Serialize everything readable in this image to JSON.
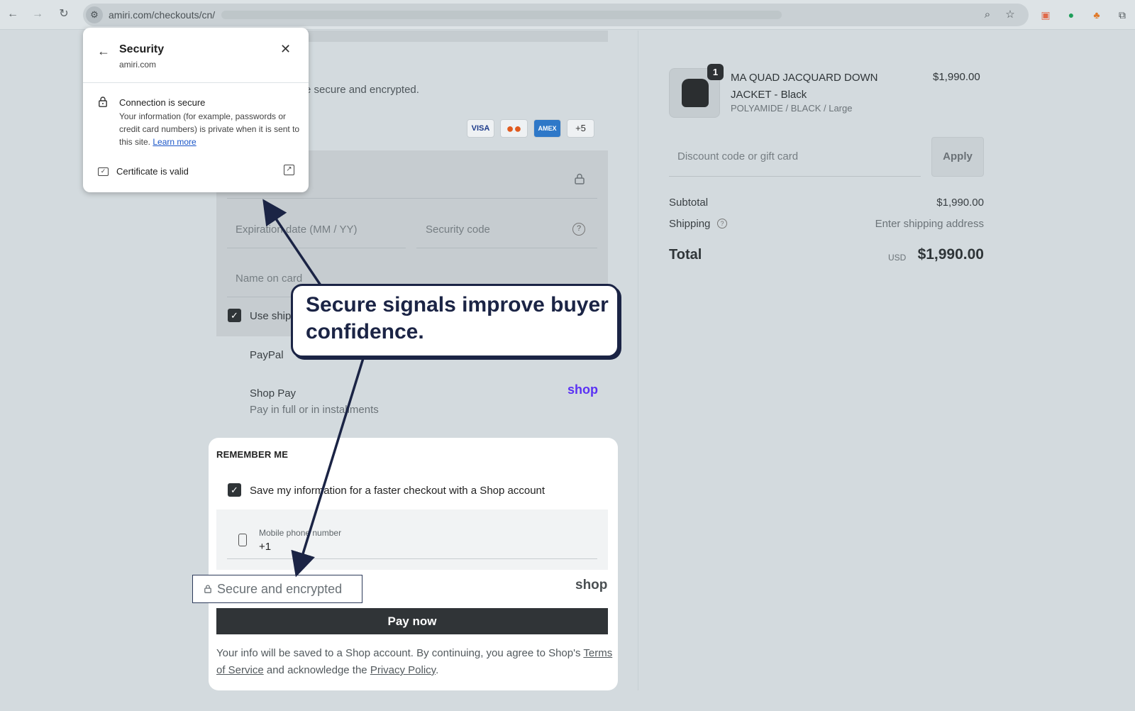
{
  "browser": {
    "url": "amiri.com/checkouts/cn/",
    "icons": [
      "back-icon",
      "forward-icon",
      "reload-icon",
      "site-settings-icon",
      "zoom-icon",
      "bookmark-star-icon",
      "extensions-icon"
    ]
  },
  "checkout": {
    "secure_note": "e secure and encrypted.",
    "card_brands": [
      "VISA",
      "●●",
      "AMEX",
      "+5"
    ],
    "fields": {
      "expiration": "Expiration date (MM / YY)",
      "security_code": "Security code",
      "name_on_card": "Name on card"
    },
    "use_shipping_label": "Use ship",
    "paypal_label": "PayPal",
    "shoppay_label": "Shop Pay",
    "shoppay_sub": "Pay in full or in installments",
    "shop_logo": "shop"
  },
  "remember": {
    "title": "REMEMBER ME",
    "save_label": "Save my information for a faster checkout with a Shop account",
    "phone_label": "Mobile phone number",
    "phone_value": "+1",
    "secure_label": "Secure and encrypted",
    "shop_logo": "shop",
    "pay_button": "Pay now",
    "terms_part1": "Your info will be saved to a Shop account. By continuing, you agree to Shop's ",
    "terms_link": "Terms of Service",
    "terms_part2": " and acknowledge the ",
    "privacy_link": "Privacy Policy",
    "terms_end": "."
  },
  "popup": {
    "title": "Security",
    "domain": "amiri.com",
    "connection_title": "Connection is secure",
    "connection_body": "Your information (for example, passwords or credit card numbers) is private when it is sent to this site. ",
    "learn_more": "Learn more",
    "certificate": "Certificate is valid"
  },
  "callout": {
    "text": "Secure signals improve buyer confidence."
  },
  "summary": {
    "quantity": "1",
    "product_name": "MA QUAD JACQUARD DOWN JACKET - Black",
    "product_variant": "POLYAMIDE / BLACK / Large",
    "product_price": "$1,990.00",
    "discount_placeholder": "Discount code or gift card",
    "apply_label": "Apply",
    "subtotal_label": "Subtotal",
    "subtotal_value": "$1,990.00",
    "shipping_label": "Shipping",
    "shipping_value": "Enter shipping address",
    "total_label": "Total",
    "total_currency": "USD",
    "total_value": "$1,990.00"
  }
}
